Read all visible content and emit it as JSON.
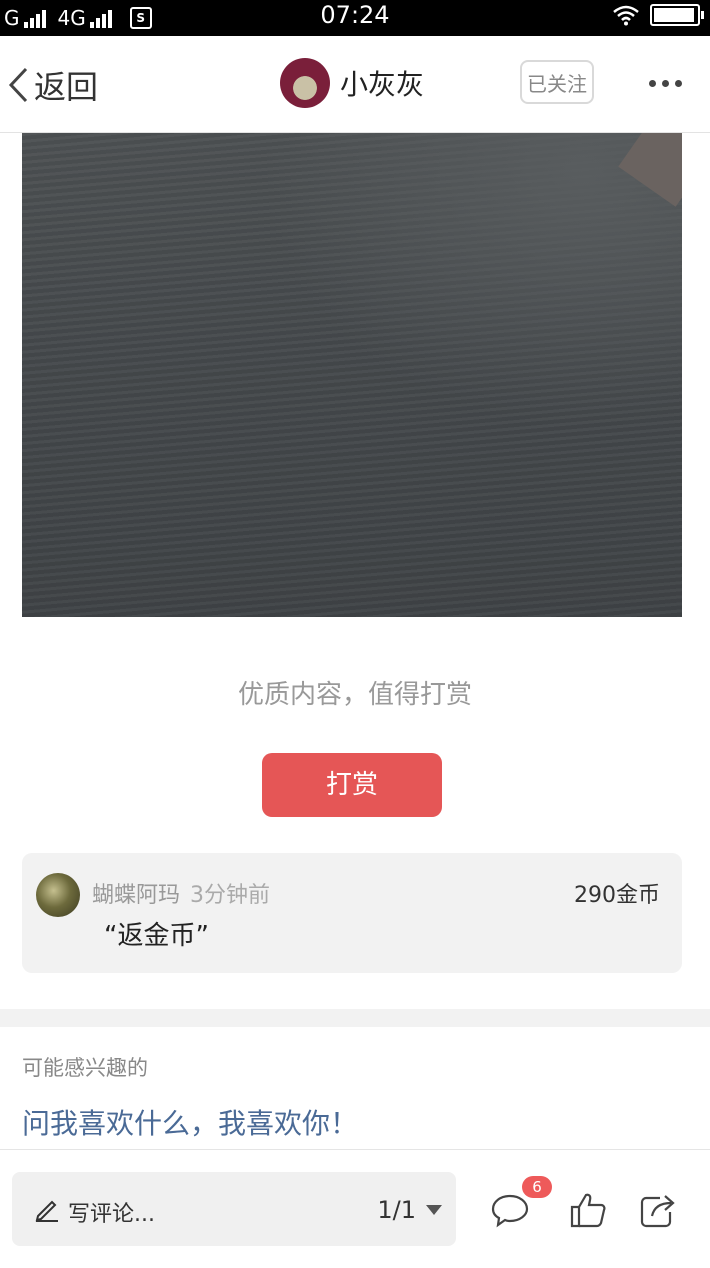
{
  "status_bar": {
    "carrier_left": "G",
    "network": "4G",
    "time": "07:24",
    "battery_level": 0.95
  },
  "header": {
    "back_label": "返回",
    "username": "小灰灰",
    "follow_label": "已关注"
  },
  "post": {
    "reward_prompt": "优质内容，值得打赏",
    "reward_button": "打赏"
  },
  "tips": [
    {
      "name": "蝴蝶阿玛",
      "time": "3分钟前",
      "amount": "290金币",
      "message": "“返金币”"
    }
  ],
  "recommend": {
    "title": "可能感兴趣的",
    "item": "问我喜欢什么，我喜欢你！"
  },
  "bottom_bar": {
    "comment_placeholder": "写评论...",
    "page_indicator": "1/1",
    "comment_count": "6"
  },
  "colors": {
    "accent": "#e55656",
    "link": "#4a6a96",
    "badge": "#ee5a5a"
  },
  "icons": [
    "back-chevron-icon",
    "more-dots-icon",
    "pen-icon",
    "dropdown-triangle-icon",
    "comment-bubble-icon",
    "thumbs-up-icon",
    "share-icon"
  ]
}
